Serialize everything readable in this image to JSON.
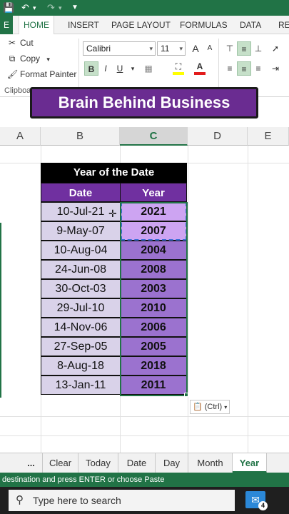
{
  "ribbon_tabs": [
    {
      "label": "HOME"
    },
    {
      "label": "INSERT"
    },
    {
      "label": "PAGE LAYOUT"
    },
    {
      "label": "FORMULAS"
    },
    {
      "label": "DATA"
    },
    {
      "label": "REV"
    }
  ],
  "clipboard": {
    "cut": "Cut",
    "copy": "Copy",
    "format_painter": "Format Painter",
    "group_label": "Clipboa"
  },
  "font": {
    "name": "Calibri",
    "size": "11",
    "grow": "A",
    "shrink": "A",
    "bold": "B",
    "italic": "I",
    "underline": "U"
  },
  "banner": {
    "text": "Brain Behind Business"
  },
  "columns": [
    "A",
    "B",
    "C",
    "D",
    "E"
  ],
  "table": {
    "title": "Year of the Date",
    "headers": [
      "Date",
      "Year"
    ],
    "rows": [
      {
        "date": "10-Jul-21",
        "year": "2021"
      },
      {
        "date": "9-May-07",
        "year": "2007"
      },
      {
        "date": "10-Aug-04",
        "year": "2004"
      },
      {
        "date": "24-Jun-08",
        "year": "2008"
      },
      {
        "date": "30-Oct-03",
        "year": "2003"
      },
      {
        "date": "29-Jul-10",
        "year": "2010"
      },
      {
        "date": "14-Nov-06",
        "year": "2006"
      },
      {
        "date": "27-Sep-05",
        "year": "2005"
      },
      {
        "date": "8-Aug-18",
        "year": "2018"
      },
      {
        "date": "13-Jan-11",
        "year": "2011"
      }
    ]
  },
  "paste_options": {
    "label": "(Ctrl)"
  },
  "sheet_tabs": {
    "more": "...",
    "tabs": [
      "Clear",
      "Today",
      "Date",
      "Day",
      "Month",
      "Year"
    ],
    "active": "Year"
  },
  "status": {
    "text": "destination and press ENTER or choose Paste"
  },
  "taskbar": {
    "search_placeholder": "Type here to search",
    "mail_badge": "4"
  },
  "colors": {
    "excel_green": "#217346",
    "banner_purple": "#6a2c91",
    "header_purple": "#7030a0",
    "date_fill": "#d9d2e9",
    "year_fill": "#9b72cf"
  }
}
